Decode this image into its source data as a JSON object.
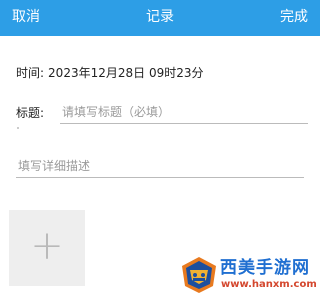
{
  "header": {
    "cancel_label": "取消",
    "title": "记录",
    "done_label": "完成",
    "color": "#2d9ee6"
  },
  "time": {
    "label": "时间:",
    "value": "2023年12月28日 09时23分"
  },
  "title_field": {
    "label": "标题:",
    "placeholder": "请填写标题（必填）",
    "value": ""
  },
  "description_field": {
    "placeholder": "填写详细描述",
    "value": ""
  },
  "add_photo": {
    "icon": "plus-icon",
    "glyph": "+"
  },
  "watermark": {
    "brand": "西美手游网",
    "url": "www.hanxm.com"
  }
}
